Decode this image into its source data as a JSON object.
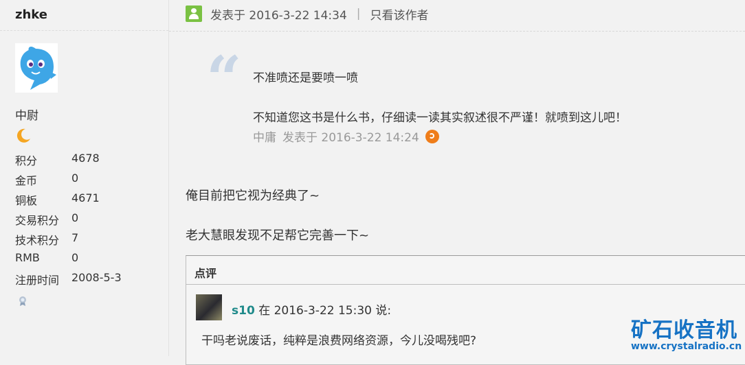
{
  "user": {
    "name": "zhke",
    "rank": "中尉",
    "stats": [
      {
        "label": "积分",
        "value": "4678"
      },
      {
        "label": "金币",
        "value": "0"
      },
      {
        "label": "铜板",
        "value": "4671"
      },
      {
        "label": "交易积分",
        "value": "0"
      },
      {
        "label": "技术积分",
        "value": "7"
      },
      {
        "label": "RMB",
        "value": "0"
      },
      {
        "label": "注册时间",
        "value": "2008-5-3"
      }
    ]
  },
  "post": {
    "posted_at": "发表于 2016-3-22 14:34",
    "separator": "|",
    "author_only": "只看该作者",
    "quote": {
      "line1": "不准喷还是要喷一喷",
      "line2": "不知道您这书是什么书，仔细读一读其实叙述很不严谨！就喷到这儿吧！",
      "author": "中庸",
      "posted_at": "发表于 2016-3-22 14:24"
    },
    "body": [
      "俺目前把它视为经典了~",
      "老大慧眼发现不足帮它完善一下~"
    ]
  },
  "comments": {
    "title": "点评",
    "items": [
      {
        "user": "s10",
        "meta": "在 2016-3-22 15:30 说:",
        "text": "干吗老说废话，纯粹是浪费网络资源，今儿没喝残吧?"
      }
    ]
  },
  "watermark": {
    "title": "矿石收音机",
    "url": "www.crystalradio.cn"
  },
  "colors": {
    "accent": "#7ac143",
    "link": "#1f8a8a",
    "watermark": "#1672c4",
    "quote_mark": "#c9d6e6"
  }
}
